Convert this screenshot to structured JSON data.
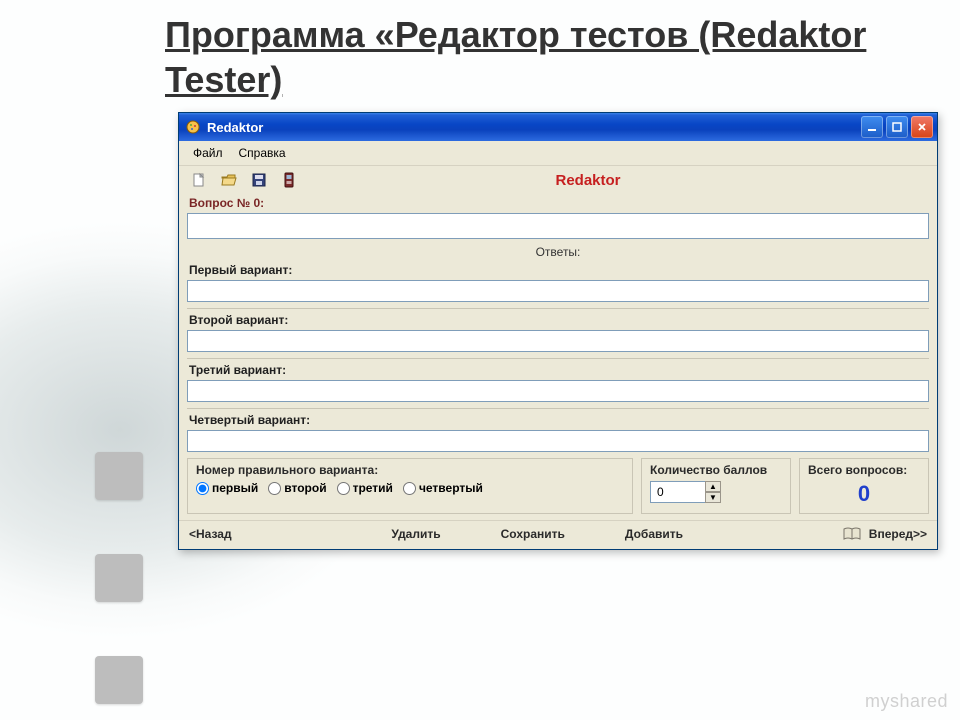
{
  "slide": {
    "title": "Программа «Редактор тестов (Redaktor Tester)",
    "watermark": "myshared"
  },
  "window": {
    "title": "Redaktor",
    "menu": {
      "file": "Файл",
      "help": "Справка"
    },
    "app_name": "Redaktor",
    "icons": {
      "app": "app-icon",
      "new": "new-file-icon",
      "open": "open-folder-icon",
      "save": "save-disk-icon",
      "device": "device-icon",
      "minimize": "minimize-icon",
      "maximize": "maximize-icon",
      "close": "close-icon",
      "book": "book-icon"
    }
  },
  "form": {
    "question_label": "Вопрос № 0:",
    "question_value": "",
    "answers_header": "Ответы:",
    "variants": [
      {
        "label": "Первый вариант:",
        "value": ""
      },
      {
        "label": "Второй вариант:",
        "value": ""
      },
      {
        "label": "Третий вариант:",
        "value": ""
      },
      {
        "label": "Четвертый вариант:",
        "value": ""
      }
    ],
    "correct": {
      "title": "Номер правильного варианта:",
      "options": [
        "первый",
        "второй",
        "третий",
        "четвертый"
      ],
      "selected": 0
    },
    "points": {
      "title": "Количество баллов",
      "value": "0"
    },
    "total": {
      "title": "Всего вопросов:",
      "value": "0"
    }
  },
  "nav": {
    "back": "<Назад",
    "delete": "Удалить",
    "save": "Сохранить",
    "add": "Добавить",
    "forward": "Вперед>>"
  }
}
